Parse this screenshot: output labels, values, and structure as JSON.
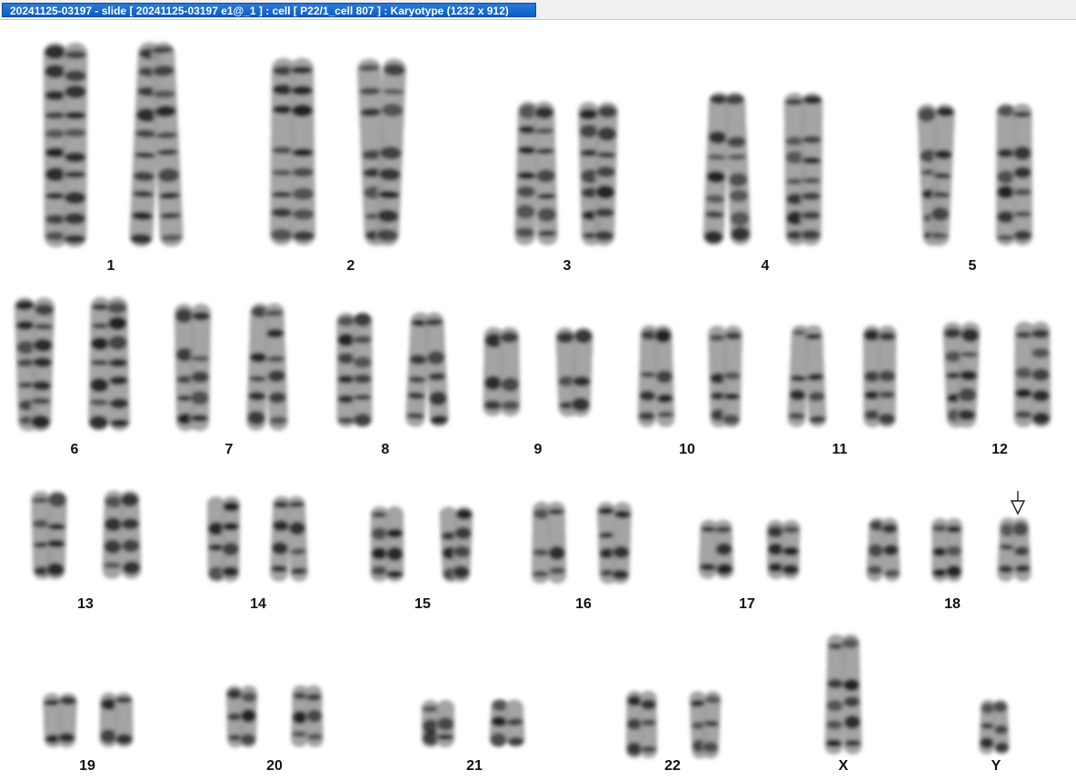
{
  "window": {
    "title": "20241125-03197 - slide [ 20241125-03197 e1@_1 ] : cell [ P22/1_cell 807 ] : Karyotype  (1232 x 912)"
  },
  "karyotype": {
    "groups": [
      {
        "label": "1",
        "count": 2
      },
      {
        "label": "2",
        "count": 2
      },
      {
        "label": "3",
        "count": 2
      },
      {
        "label": "4",
        "count": 2
      },
      {
        "label": "5",
        "count": 2
      },
      {
        "label": "6",
        "count": 2
      },
      {
        "label": "7",
        "count": 2
      },
      {
        "label": "8",
        "count": 2
      },
      {
        "label": "9",
        "count": 2
      },
      {
        "label": "10",
        "count": 2
      },
      {
        "label": "11",
        "count": 2
      },
      {
        "label": "12",
        "count": 2
      },
      {
        "label": "13",
        "count": 2
      },
      {
        "label": "14",
        "count": 2
      },
      {
        "label": "15",
        "count": 2
      },
      {
        "label": "16",
        "count": 2
      },
      {
        "label": "17",
        "count": 2
      },
      {
        "label": "18",
        "count": 3,
        "marked": true
      },
      {
        "label": "19",
        "count": 2
      },
      {
        "label": "20",
        "count": 2
      },
      {
        "label": "21",
        "count": 2
      },
      {
        "label": "22",
        "count": 2
      },
      {
        "label": "X",
        "count": 1
      },
      {
        "label": "Y",
        "count": 1
      }
    ]
  },
  "colors": {
    "title_bg": "#0a5ec4",
    "chromosome_dark": "#1a1a1a",
    "chromosome_light": "#9a9a9a"
  }
}
